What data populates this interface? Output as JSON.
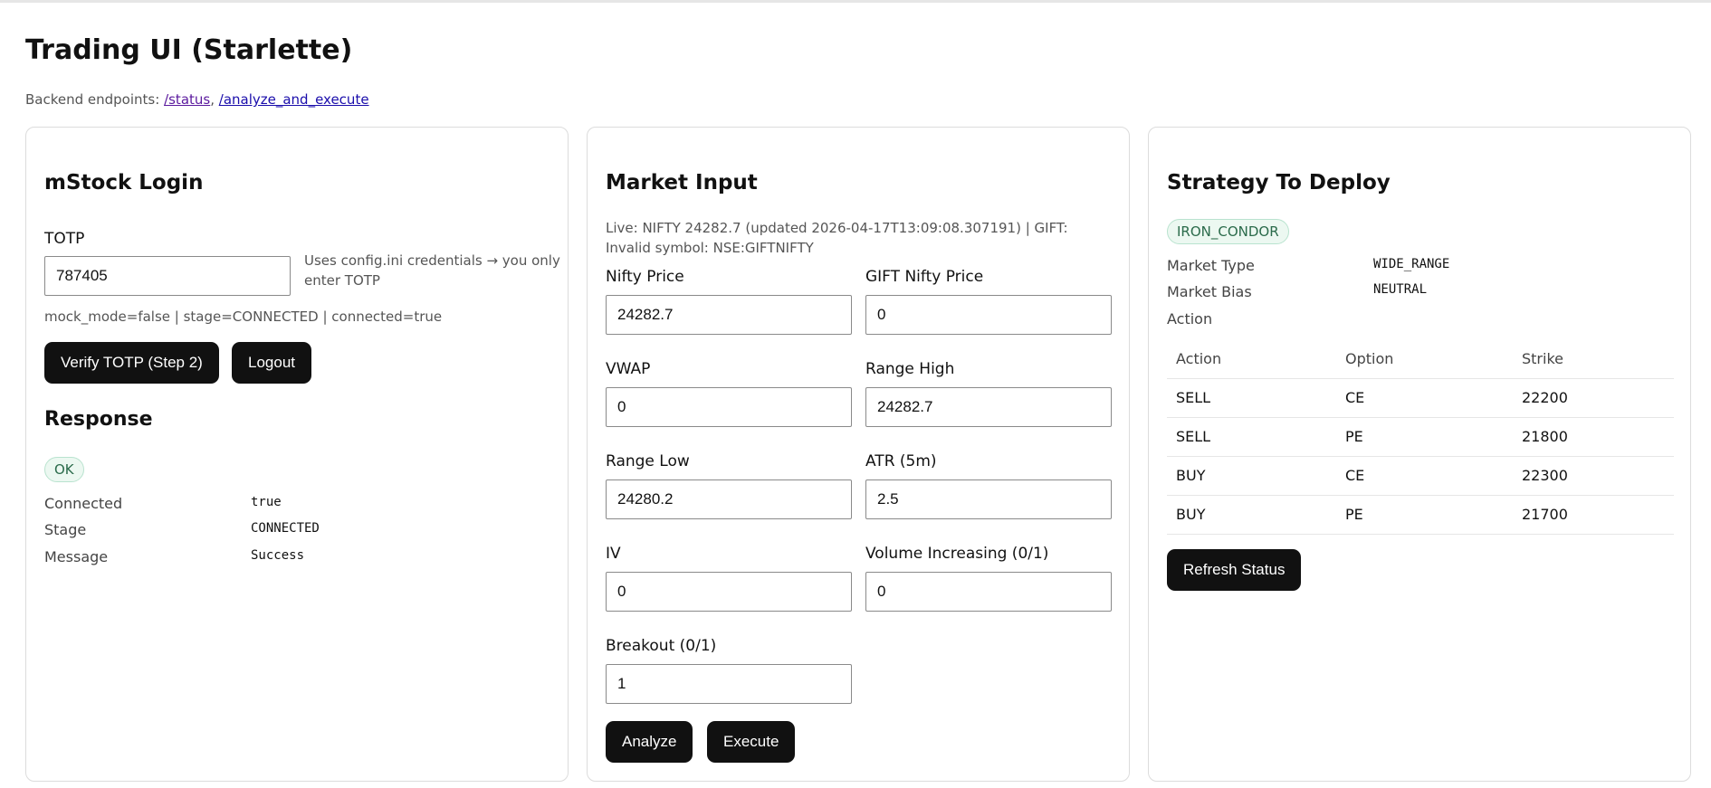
{
  "page": {
    "title": "Trading UI (Starlette)",
    "endpoints_prefix": "Backend endpoints: ",
    "endpoint_status": "/status",
    "endpoint_sep": ", ",
    "endpoint_analyze": "/analyze_and_execute"
  },
  "login": {
    "title": "mStock Login",
    "totp_label": "TOTP",
    "totp_value": "787405",
    "hint": "Uses config.ini credentials → you only enter TOTP",
    "state_line": "mock_mode=false | stage=CONNECTED | connected=true",
    "verify_button": "Verify TOTP (Step 2)",
    "logout_button": "Logout"
  },
  "response": {
    "title": "Response",
    "badge": "OK",
    "rows": [
      {
        "key": "Connected",
        "value": "true"
      },
      {
        "key": "Stage",
        "value": "CONNECTED"
      },
      {
        "key": "Message",
        "value": "Success"
      }
    ]
  },
  "market": {
    "title": "Market Input",
    "live_text": "Live: NIFTY 24282.7 (updated 2026-04-17T13:09:08.307191) | GIFT: Invalid symbol: NSE:GIFTNIFTY",
    "fields": {
      "nifty_price": {
        "label": "Nifty Price",
        "value": "24282.7"
      },
      "gift_nifty_price": {
        "label": "GIFT Nifty Price",
        "value": "0"
      },
      "vwap": {
        "label": "VWAP",
        "value": "0"
      },
      "range_high": {
        "label": "Range High",
        "value": "24282.7"
      },
      "range_low": {
        "label": "Range Low",
        "value": "24280.2"
      },
      "atr": {
        "label": "ATR (5m)",
        "value": "2.5"
      },
      "iv": {
        "label": "IV",
        "value": "0"
      },
      "volume_increasing": {
        "label": "Volume Increasing (0/1)",
        "value": "0"
      },
      "breakout": {
        "label": "Breakout (0/1)",
        "value": "1"
      }
    },
    "analyze_button": "Analyze",
    "execute_button": "Execute"
  },
  "strategy": {
    "title": "Strategy To Deploy",
    "badge": "IRON_CONDOR",
    "market_type_label": "Market Type",
    "market_type_value": "WIDE_RANGE",
    "market_bias_label": "Market Bias",
    "market_bias_value": "NEUTRAL",
    "action_label": "Action",
    "table": {
      "headers": [
        "Action",
        "Option",
        "Strike"
      ],
      "rows": [
        [
          "SELL",
          "CE",
          "22200"
        ],
        [
          "SELL",
          "PE",
          "21800"
        ],
        [
          "BUY",
          "CE",
          "22300"
        ],
        [
          "BUY",
          "PE",
          "21700"
        ]
      ]
    },
    "refresh_button": "Refresh Status"
  }
}
